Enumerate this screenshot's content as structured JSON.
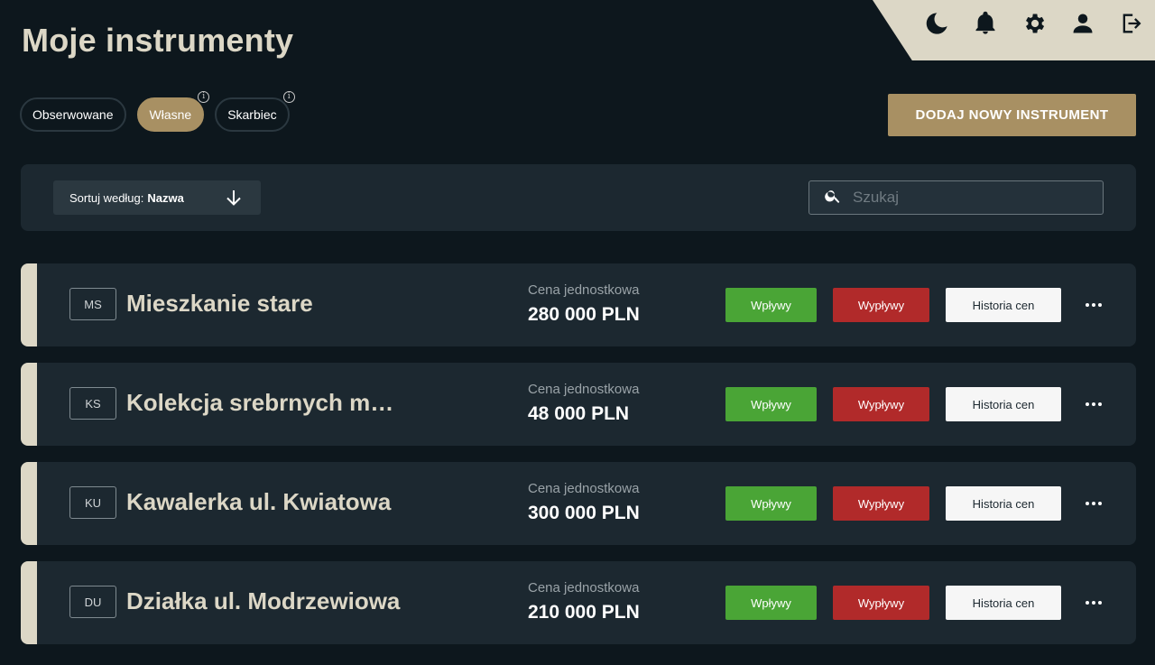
{
  "header": {
    "title": "Moje instrumenty",
    "icons": [
      "moon-icon",
      "bell-icon",
      "gear-icon",
      "user-icon",
      "logout-icon"
    ]
  },
  "filters": {
    "chips": [
      {
        "label": "Obserwowane",
        "active": false,
        "info": false
      },
      {
        "label": "Własne",
        "active": true,
        "info": true
      },
      {
        "label": "Skarbiec",
        "active": false,
        "info": true
      }
    ],
    "info_symbol": "i"
  },
  "add_button": {
    "label": "DODAJ NOWY INSTRUMENT"
  },
  "toolbar": {
    "sort_label": "Sortuj według:",
    "sort_value": "Nazwa",
    "search_placeholder": "Szukaj"
  },
  "instruments": [
    {
      "abbr": "MS",
      "name": "Mieszkanie stare",
      "price_label": "Cena jednostkowa",
      "price": "280 000 PLN"
    },
    {
      "abbr": "KS",
      "name": "Kolekcja srebrnych mo…",
      "price_label": "Cena jednostkowa",
      "price": "48 000 PLN"
    },
    {
      "abbr": "KU",
      "name": "Kawalerka ul. Kwiatowa",
      "price_label": "Cena jednostkowa",
      "price": "300 000 PLN"
    },
    {
      "abbr": "DU",
      "name": "Działka ul. Modrzewiowa",
      "price_label": "Cena jednostkowa",
      "price": "210 000 PLN"
    }
  ],
  "row_actions": {
    "inflows": "Wpływy",
    "outflows": "Wypływy",
    "history": "Historia cen"
  },
  "colors": {
    "background": "#0d171d",
    "panel": "#1c2830",
    "accent": "#a89063",
    "cream": "#dcd7c6",
    "green": "#4aa536",
    "red": "#b12a2a"
  }
}
